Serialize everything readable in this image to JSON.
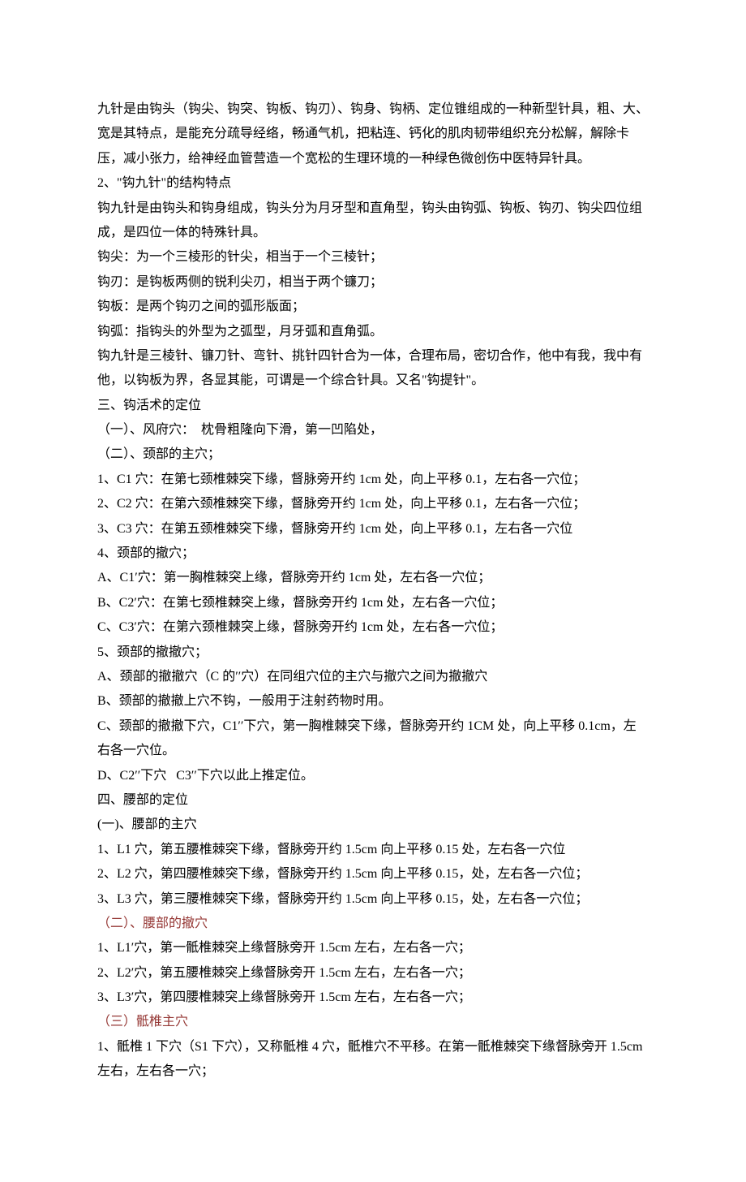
{
  "lines": [
    {
      "text": "九针是由钩头（钩尖、钩突、钩板、钩刃）、钩身、钩柄、定位锥组成的一种新型针具，粗、大、宽是其特点，是能充分疏导经络，畅通气机，把粘连、钙化的肌肉韧带组织充分松解，解除卡压，减小张力，给神经血管营造一个宽松的生理环境的一种绿色微创伤中医特异针具。"
    },
    {
      "text": "2、\"钩九针\"的结构特点"
    },
    {
      "text": "钩九针是由钩头和钩身组成，钩头分为月牙型和直角型，钩头由钩弧、钩板、钩刃、钩尖四位组成，是四位一体的特殊针具。"
    },
    {
      "text": "钩尖：为一个三棱形的针尖，相当于一个三棱针；"
    },
    {
      "text": "钩刃：是钩板两侧的锐利尖刃，相当于两个镰刀；"
    },
    {
      "text": "钩板：是两个钩刃之间的弧形版面；"
    },
    {
      "text": "钩弧：指钩头的外型为之弧型，月牙弧和直角弧。"
    },
    {
      "text": "钩九针是三棱针、镰刀针、弯针、挑针四针合为一体，合理布局，密切合作，他中有我，我中有他，以钩板为界，各显其能，可谓是一个综合针具。又名\"钩提针\"。"
    },
    {
      "text": "三、钩活术的定位"
    },
    {
      "text": "（一）、风府穴：  枕骨粗隆向下滑，第一凹陷处，"
    },
    {
      "text": "（二）、颈部的主穴；"
    },
    {
      "text": "1、C1 穴：在第七颈椎棘突下缘，督脉旁开约 1cm 处，向上平移 0.1，左右各一穴位；"
    },
    {
      "text": "2、C2 穴：在第六颈椎棘突下缘，督脉旁开约 1cm 处，向上平移 0.1，左右各一穴位；"
    },
    {
      "text": "3、C3 穴：在第五颈椎棘突下缘，督脉旁开约 1cm 处，向上平移 0.1，左右各一穴位"
    },
    {
      "text": "4、颈部的撤穴；"
    },
    {
      "text": "A、C1′穴：第一胸椎棘突上缘，督脉旁开约 1cm 处，左右各一穴位；"
    },
    {
      "text": "B、C2′穴：在第七颈椎棘突上缘，督脉旁开约 1cm 处，左右各一穴位；"
    },
    {
      "text": "C、C3′穴：在第六颈椎棘突上缘，督脉旁开约 1cm 处，左右各一穴位；"
    },
    {
      "text": "5、颈部的撤撤穴；"
    },
    {
      "text": "A、颈部的撤撤穴（C 的′′穴）在同组穴位的主穴与撤穴之间为撤撤穴"
    },
    {
      "text": "B、颈部的撤撤上穴不钩，一般用于注射药物时用。"
    },
    {
      "text": "C、颈部的撤撤下穴，C1′′下穴，第一胸椎棘突下缘，督脉旁开约 1CM 处，向上平移 0.1cm，左右各一穴位。"
    },
    {
      "text": "D、C2′′下穴   C3′′下穴以此上推定位。"
    },
    {
      "text": "四、腰部的定位"
    },
    {
      "text": "(一)、腰部的主穴"
    },
    {
      "text": "1、L1 穴，第五腰椎棘突下缘，督脉旁开约 1.5cm 向上平移 0.15 处，左右各一穴位"
    },
    {
      "text": "2、L2 穴，第四腰椎棘突下缘，督脉旁开约 1.5cm 向上平移 0.15，处，左右各一穴位；"
    },
    {
      "text": "3、L3 穴，第三腰椎棘突下缘，督脉旁开约 1.5cm 向上平移 0.15，处，左右各一穴位；"
    },
    {
      "text": "（二）、腰部的撤穴",
      "colored": true
    },
    {
      "text": "1、L1′穴，第一骶椎棘突上缘督脉旁开 1.5cm 左右，左右各一穴；"
    },
    {
      "text": "2、L2′穴，第五腰椎棘突上缘督脉旁开 1.5cm 左右，左右各一穴；"
    },
    {
      "text": "3、L3′穴，第四腰椎棘突上缘督脉旁开 1.5cm 左右，左右各一穴；"
    },
    {
      "text": "（三）骶椎主穴",
      "colored": true
    },
    {
      "text": "1、骶椎 1 下穴（S1 下穴），又称骶椎 4 穴，骶椎穴不平移。在第一骶椎棘突下缘督脉旁开 1.5cm 左右，左右各一穴；"
    }
  ]
}
